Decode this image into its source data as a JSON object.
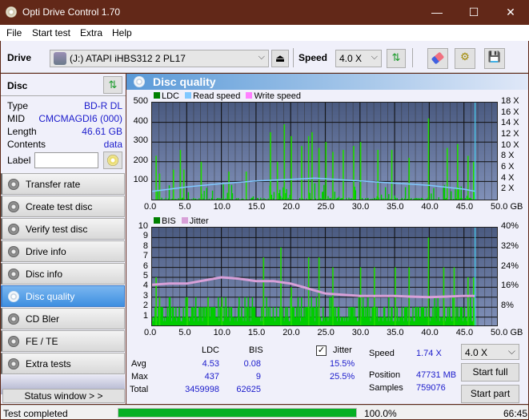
{
  "window": {
    "title": "Opti Drive Control 1.70",
    "minimize": "—",
    "maximize": "☐",
    "close": "✕"
  },
  "menu": [
    "File",
    "Start test",
    "Extra",
    "Help"
  ],
  "toolbar": {
    "drive_label": "Drive",
    "drive_value": "(J:)  ATAPI iHBS312   2 PL17",
    "speed_label": "Speed",
    "speed_value": "4.0 X",
    "eject_icon": "eject-icon",
    "refresh_icon": "refresh-icon",
    "erase_icon": "eraser-icon",
    "settings_icon": "gears-icon",
    "save_icon": "save-icon"
  },
  "disc": {
    "title": "Disc",
    "rows": [
      {
        "k": "Type",
        "v": "BD-R DL"
      },
      {
        "k": "MID",
        "v": "CMCMAGDI6 (000)"
      },
      {
        "k": "Length",
        "v": "46.61 GB"
      },
      {
        "k": "Contents",
        "v": "data"
      }
    ],
    "label_key": "Label",
    "label_value": ""
  },
  "nav": [
    {
      "label": "Transfer rate",
      "active": false
    },
    {
      "label": "Create test disc",
      "active": false
    },
    {
      "label": "Verify test disc",
      "active": false
    },
    {
      "label": "Drive info",
      "active": false
    },
    {
      "label": "Disc info",
      "active": false
    },
    {
      "label": "Disc quality",
      "active": true
    },
    {
      "label": "CD Bler",
      "active": false
    },
    {
      "label": "FE / TE",
      "active": false
    },
    {
      "label": "Extra tests",
      "active": false
    }
  ],
  "status_window_btn": "Status window > >",
  "panel_title": "Disc quality",
  "colors": {
    "ldc": "#008000",
    "bis": "#008000",
    "read_speed": "#80c8ff",
    "write_speed": "#ff80ff",
    "jitter": "#d8a0d8",
    "bars": "#00cc00",
    "accent": "#3e8fe0"
  },
  "chart_data": [
    {
      "type": "bar",
      "title": "LDC",
      "legend": [
        "LDC",
        "Read speed",
        "Write speed"
      ],
      "xlabel": "GB",
      "x_ticks": [
        "0.0",
        "5.0",
        "10.0",
        "15.0",
        "20.0",
        "25.0",
        "30.0",
        "35.0",
        "40.0",
        "45.0",
        "50.0 GB"
      ],
      "xlim": [
        0,
        50
      ],
      "y_ticks": [
        "500",
        "400",
        "300",
        "200",
        "100"
      ],
      "ylim": [
        0,
        500
      ],
      "y2_ticks": [
        "18 X",
        "16 X",
        "14 X",
        "12 X",
        "10 X",
        "8 X",
        "6 X",
        "4 X",
        "2 X"
      ],
      "y2lim": [
        0,
        18
      ],
      "end_marker_gb": 46.61,
      "read_speed": {
        "x": [
          0,
          5,
          10,
          15,
          20,
          23.5,
          25,
          30,
          35,
          40,
          45,
          46.6
        ],
        "y": [
          1.8,
          2.6,
          3.2,
          3.7,
          4.0,
          4.2,
          4.1,
          3.7,
          3.3,
          2.9,
          2.2,
          1.8
        ]
      },
      "ldc_peaks": {
        "x": [
          0.5,
          1,
          3,
          4,
          4.5,
          7,
          11,
          13.5,
          17,
          18,
          19,
          20,
          21.5,
          22.5,
          23,
          24,
          25,
          26,
          27.5,
          29,
          30,
          32.5,
          34.5,
          37,
          39.8,
          42.5,
          44,
          45.5,
          46.3
        ],
        "y": [
          230,
          140,
          160,
          260,
          160,
          200,
          150,
          150,
          350,
          200,
          390,
          330,
          280,
          330,
          350,
          270,
          300,
          250,
          260,
          280,
          300,
          260,
          260,
          220,
          420,
          270,
          290,
          230,
          200
        ]
      }
    },
    {
      "type": "bar",
      "title": "BIS",
      "legend": [
        "BIS",
        "Jitter"
      ],
      "xlabel": "GB",
      "x_ticks": [
        "0.0",
        "5.0",
        "10.0",
        "15.0",
        "20.0",
        "25.0",
        "30.0",
        "35.0",
        "40.0",
        "45.0",
        "50.0 GB"
      ],
      "xlim": [
        0,
        50
      ],
      "y_ticks": [
        "10",
        "9",
        "8",
        "7",
        "6",
        "5",
        "4",
        "3",
        "2",
        "1"
      ],
      "ylim": [
        0,
        10
      ],
      "y2_ticks": [
        "40%",
        "32%",
        "24%",
        "16%",
        "8%"
      ],
      "y2lim": [
        0,
        40
      ],
      "end_marker_gb": 46.61,
      "jitter": {
        "x": [
          0,
          2.5,
          5,
          7,
          10,
          12.5,
          15,
          17.5,
          20,
          22.5,
          25,
          30,
          35,
          40,
          45,
          46.6
        ],
        "y": [
          17,
          17.5,
          17.5,
          18.5,
          20,
          19.5,
          18.5,
          18.5,
          17.5,
          15.5,
          13.5,
          12.5,
          12.5,
          12,
          12.5,
          12.5
        ]
      },
      "bis_peaks": {
        "x": [
          0.5,
          1,
          5,
          8,
          10,
          16,
          18.5,
          20,
          22.5,
          24,
          26,
          30,
          32,
          35,
          37,
          39.8,
          42,
          43.5,
          45.5,
          46.3
        ],
        "y": [
          5,
          3,
          3,
          3,
          3,
          7,
          8,
          4,
          7,
          7,
          6,
          6,
          6,
          6,
          6,
          9,
          6,
          6,
          5,
          5
        ]
      }
    }
  ],
  "stats": {
    "col_ldc": "LDC",
    "col_bis": "BIS",
    "rows": [
      {
        "k": "Avg",
        "ldc": "4.53",
        "bis": "0.08",
        "jitter": "15.5%"
      },
      {
        "k": "Max",
        "ldc": "437",
        "bis": "9",
        "jitter": "25.5%"
      },
      {
        "k": "Total",
        "ldc": "3459998",
        "bis": "62625"
      }
    ],
    "jitter_label": "Jitter",
    "jitter_checked": true,
    "speed_label": "Speed",
    "speed_value": "1.74 X",
    "position_label": "Position",
    "position_value": "47731 MB",
    "samples_label": "Samples",
    "samples_value": "759076",
    "speed_select": "4.0 X",
    "start_full": "Start full",
    "start_part": "Start part"
  },
  "statusbar": {
    "text": "Test completed",
    "progress": 100,
    "progress_text": "100.0%",
    "time": "66:45"
  }
}
